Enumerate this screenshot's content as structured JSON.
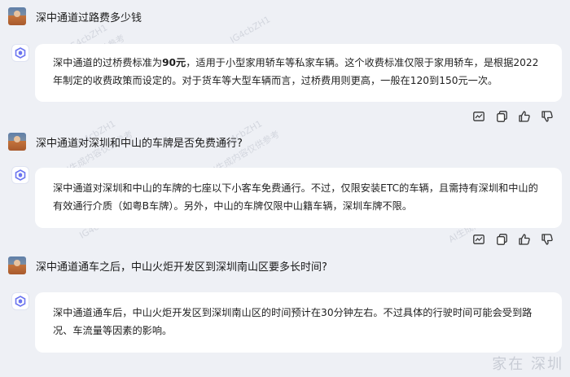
{
  "conversation": [
    {
      "question": "深中通道过路费多少钱",
      "answer": [
        {
          "text": "深中通道的过桥费标准为",
          "bold": false
        },
        {
          "text": "90元",
          "bold": true
        },
        {
          "text": "，适用于小型家用轿车等私家车辆。这个收费标准仅限于家用轿车，是根据2022年制定的收费政策而设定的。对于货车等大型车辆而言，过桥费用则更高，一般在120到150元一次。",
          "bold": false
        }
      ]
    },
    {
      "question": "深中通道对深圳和中山的车牌是否免费通行?",
      "answer": [
        {
          "text": "深中通道对深圳和中山的车牌的七座以下小客车免费通行。不过，仅限安装ETC的车辆，且需持有深圳和中山的有效通行介质（如粤B车牌）。另外，中山的车牌仅限中山籍车辆，深圳车牌不限。",
          "bold": false
        }
      ]
    },
    {
      "question": "深中通道通车之后，中山火炬开发区到深圳南山区要多长时间?",
      "answer": [
        {
          "text": "深中通道通车后，中山火炬开发区到深圳南山区的时间预计在30分钟左右。不过具体的行驶时间可能会受到路况、车流量等因素的影响。",
          "bold": false
        }
      ]
    }
  ],
  "watermark": {
    "code": "IG4cbZH1",
    "label": "AI生成内容仅供参考",
    "corner": "家在 深圳"
  },
  "icons": {
    "ai": "ai-logo-icon",
    "actions": [
      "chart-icon",
      "copy-icon",
      "thumbs-up-icon",
      "thumbs-down-icon"
    ]
  },
  "colors": {
    "background": "#eef0f5",
    "bubble": "#ffffff",
    "ai_icon": "#6b74f0"
  }
}
